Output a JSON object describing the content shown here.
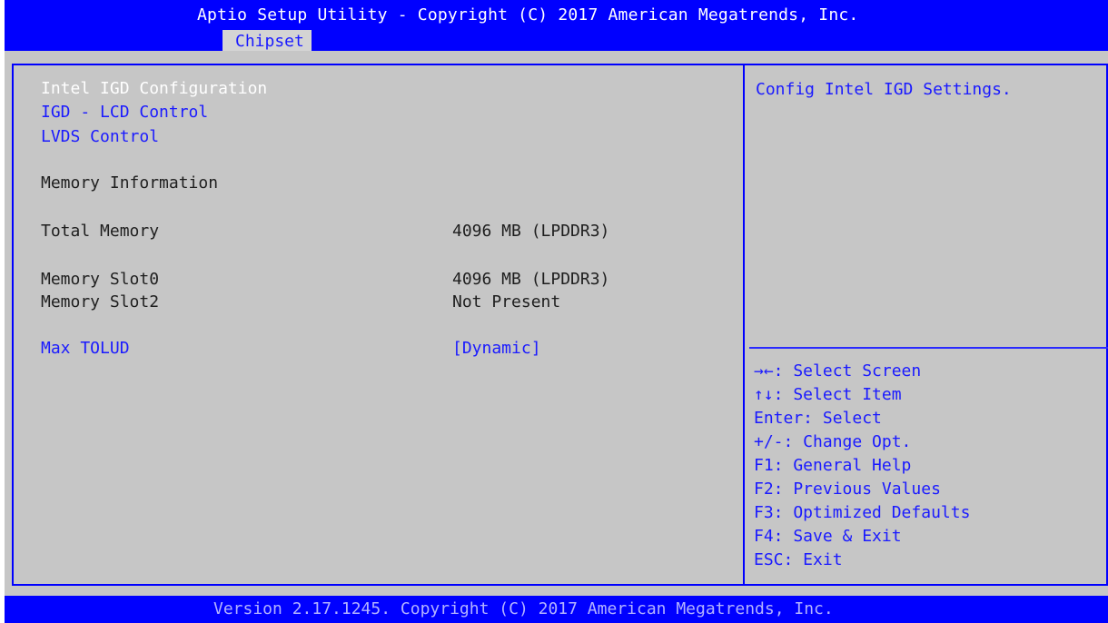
{
  "header": {
    "title": "Aptio Setup Utility - Copyright (C) 2017 American Megatrends, Inc.",
    "active_tab": "Chipset"
  },
  "menu": {
    "items": [
      {
        "label": "Intel IGD Configuration"
      },
      {
        "label": "IGD - LCD Control"
      },
      {
        "label": "LVDS Control"
      }
    ],
    "section_heading": "Memory Information",
    "total_memory": {
      "label": "Total Memory",
      "value": "4096 MB (LPDDR3)"
    },
    "slot0": {
      "label": "Memory Slot0",
      "value": "4096 MB (LPDDR3)"
    },
    "slot2": {
      "label": "Memory Slot2",
      "value": "Not Present"
    },
    "max_tolud": {
      "label": "Max TOLUD",
      "value": "[Dynamic]"
    }
  },
  "help": {
    "description": "Config Intel IGD Settings.",
    "keys": [
      "→←: Select Screen",
      "↑↓: Select Item",
      "Enter: Select",
      "+/-: Change Opt.",
      "F1: General Help",
      "F2: Previous Values",
      "F3: Optimized Defaults",
      "F4: Save & Exit",
      "ESC: Exit"
    ]
  },
  "footer": {
    "text": "Version 2.17.1245. Copyright (C) 2017 American Megatrends, Inc."
  },
  "colors": {
    "bar": "#0000ff",
    "panel": "#c6c6c6",
    "link": "#1a1aff",
    "highlight": "#ffffff"
  }
}
